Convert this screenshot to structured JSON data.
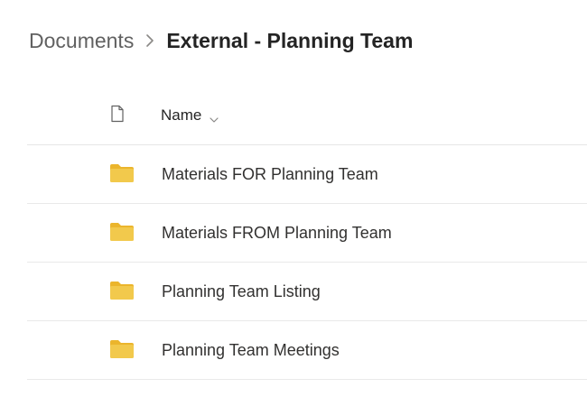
{
  "breadcrumb": {
    "parent": "Documents",
    "separator_icon": "chevron-right-icon",
    "current": "External - Planning Team"
  },
  "list": {
    "header": {
      "file_type_icon": "document-icon",
      "name_label": "Name",
      "sort_icon": "chevron-down-icon"
    },
    "items": [
      {
        "name": "Materials FOR Planning Team",
        "icon": "folder-icon"
      },
      {
        "name": "Materials FROM Planning Team",
        "icon": "folder-icon"
      },
      {
        "name": "Planning Team Listing",
        "icon": "folder-icon"
      },
      {
        "name": "Planning Team Meetings",
        "icon": "folder-icon"
      }
    ]
  },
  "colors": {
    "folder_yellow": "#f2c94c",
    "folder_dark_yellow": "#ebb52c",
    "text_primary": "#242424",
    "text_secondary": "#616161",
    "divider": "#e9e9e9"
  }
}
